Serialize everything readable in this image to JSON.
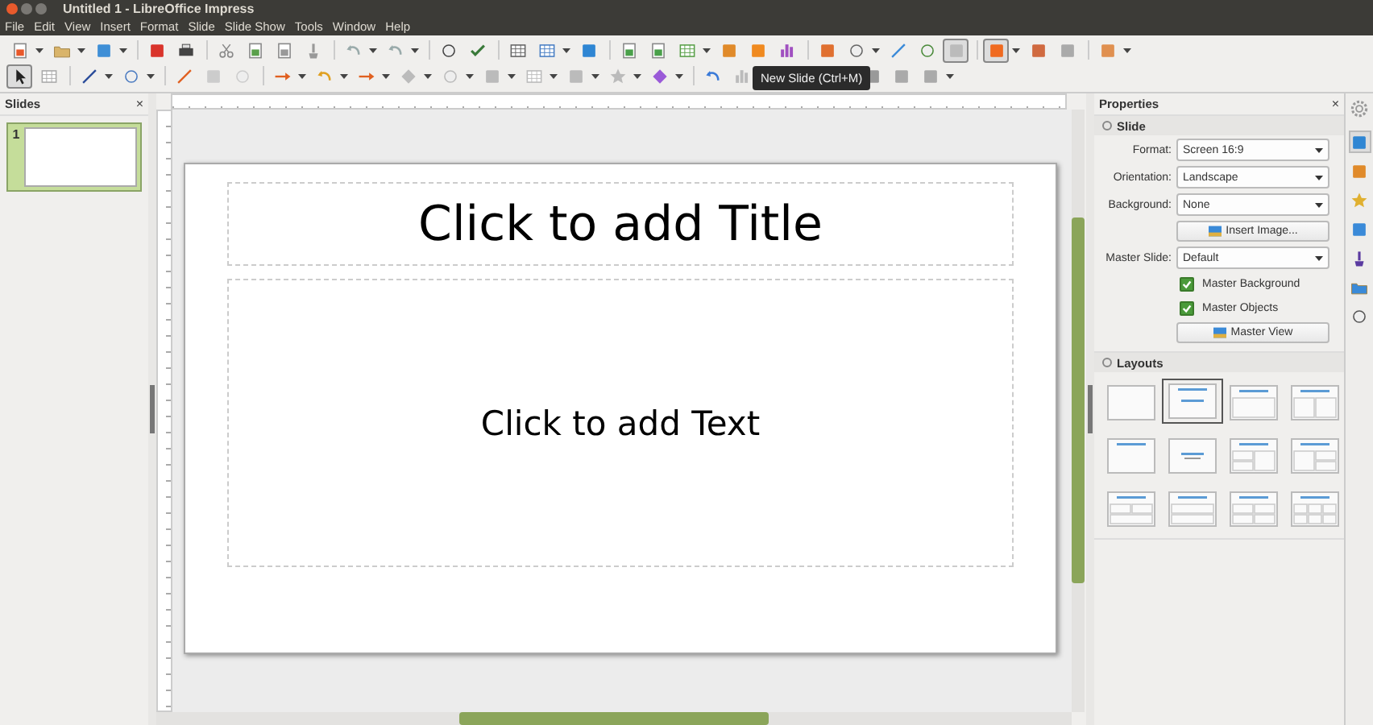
{
  "window": {
    "title": "Untitled 1 - LibreOffice Impress"
  },
  "menu": [
    "File",
    "Edit",
    "View",
    "Insert",
    "Format",
    "Slide",
    "Slide Show",
    "Tools",
    "Window",
    "Help"
  ],
  "tooltip": "New Slide (Ctrl+M)",
  "sidebar_tabs": [
    {
      "selected": false
    },
    {
      "selected": true
    },
    {
      "selected": false
    },
    {
      "selected": false
    },
    {
      "selected": false
    },
    {
      "selected": false
    },
    {
      "selected": false
    },
    {
      "selected": false
    }
  ],
  "slides_panel": {
    "title": "Slides",
    "close": "×",
    "slides": [
      {
        "number": "1",
        "selected": true
      }
    ]
  },
  "slide": {
    "title_placeholder": "Click to add Title",
    "text_placeholder": "Click to add Text"
  },
  "properties": {
    "title": "Properties",
    "close": "×",
    "section": "Slide",
    "rows": [
      {
        "kind": "dropdown",
        "label": "Format:",
        "value": "Screen 16:9"
      },
      {
        "kind": "dropdown",
        "label": "Orientation:",
        "value": "Landscape"
      },
      {
        "kind": "dropdown",
        "label": "Background:",
        "value": "None"
      },
      {
        "kind": "button",
        "label": "Insert Image..."
      },
      {
        "kind": "dropdown",
        "label": "Master Slide:",
        "value": "Default"
      },
      {
        "kind": "checkbox",
        "label": "Master Background",
        "checked": true
      },
      {
        "kind": "checkbox",
        "label": "Master Objects",
        "checked": true
      },
      {
        "kind": "button",
        "label": "Master View"
      }
    ],
    "layouts_title": "Layouts",
    "layouts": [
      {
        "kind": "blank",
        "selected": false
      },
      {
        "kind": "title-slide",
        "selected": true
      },
      {
        "kind": "title-content",
        "selected": false
      },
      {
        "kind": "title-two-content",
        "selected": false
      },
      {
        "kind": "title-only",
        "selected": false
      },
      {
        "kind": "centered-text",
        "selected": false
      },
      {
        "kind": "title-two-left-one-right",
        "selected": false
      },
      {
        "kind": "title-one-left-two-right",
        "selected": false
      },
      {
        "kind": "title-two-top-one-bottom",
        "selected": false
      },
      {
        "kind": "title-one-top-one-bottom",
        "selected": false
      },
      {
        "kind": "title-four-content",
        "selected": false
      },
      {
        "kind": "title-six-content",
        "selected": false
      }
    ]
  }
}
